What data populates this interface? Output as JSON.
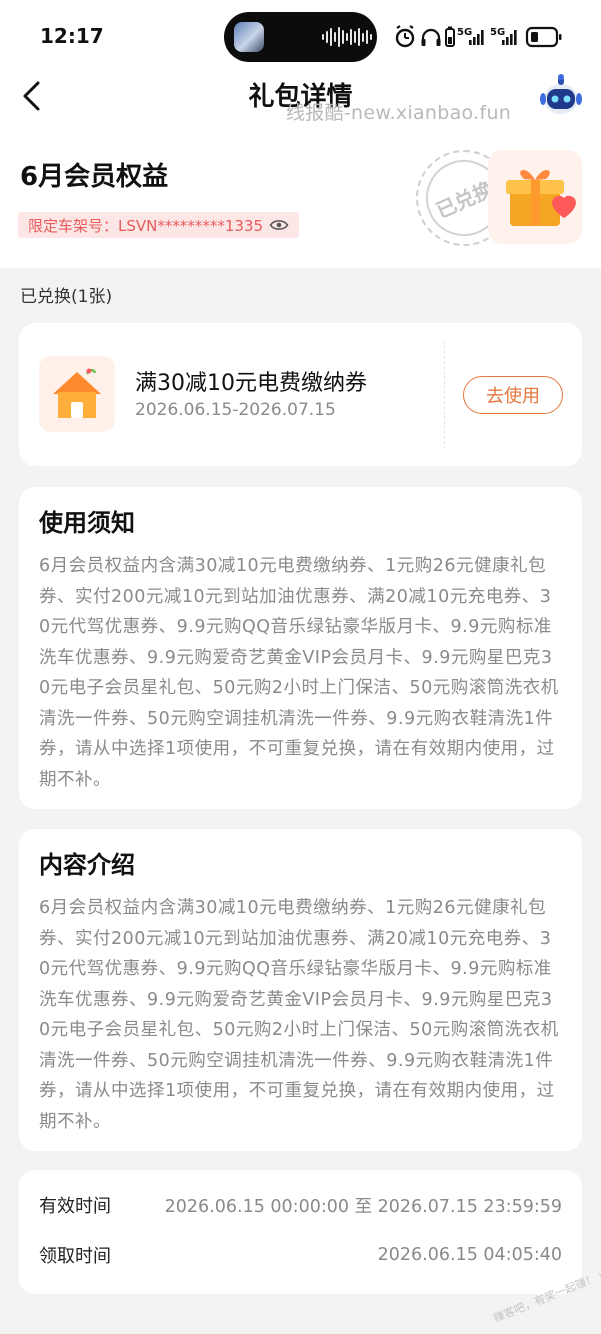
{
  "status_bar": {
    "time": "12:17",
    "network_label_1": "5G",
    "network_label_2": "5G"
  },
  "nav": {
    "title": "礼包详情",
    "back_icon": "chevron-left-icon",
    "avatar_icon": "robot-mascot-icon"
  },
  "watermark": "线报酷-new.xianbao.fun",
  "header": {
    "package_title": "6月会员权益",
    "vin_label": "限定车架号：LSVN*********1335",
    "eye_icon": "eye-icon",
    "stamp_text": "已兑换",
    "gift_icon": "gift-box-icon"
  },
  "redeemed": {
    "label": "已兑换(1张)"
  },
  "coupon": {
    "name": "满30减10元电费缴纳券",
    "validity": "2026.06.15-2026.07.15",
    "use_button": "去使用",
    "icon": "house-icon"
  },
  "notice": {
    "title": "使用须知",
    "body": "6月会员权益内含满30减10元电费缴纳券、1元购26元健康礼包券、实付200元减10元到站加油优惠券、满20减10元充电券、30元代驾优惠券、9.9元购QQ音乐绿钻豪华版月卡、9.9元购标准洗车优惠券、9.9元购爱奇艺黄金VIP会员月卡、9.9元购星巴克30元电子会员星礼包、50元购2小时上门保洁、50元购滚筒洗衣机清洗一件券、50元购空调挂机清洗一件券、9.9元购衣鞋清洗1件券，请从中选择1项使用，不可重复兑换，请在有效期内使用，过期不补。"
  },
  "intro": {
    "title": "内容介绍",
    "body": "6月会员权益内含满30减10元电费缴纳券、1元购26元健康礼包券、实付200元减10元到站加油优惠券、满20减10元充电券、30元代驾优惠券、9.9元购QQ音乐绿钻豪华版月卡、9.9元购标准洗车优惠券、9.9元购爱奇艺黄金VIP会员月卡、9.9元购星巴克30元电子会员星礼包、50元购2小时上门保洁、50元购滚筒洗衣机清洗一件券、50元购空调挂机清洗一件券、9.9元购衣鞋清洗1件券，请从中选择1项使用，不可重复兑换，请在有效期内使用，过期不补。"
  },
  "times": {
    "valid_label": "有效时间",
    "valid_value": "2026.06.15 00:00:00 至 2026.07.15 23:59:59",
    "receive_label": "领取时间",
    "receive_value": "2026.06.15 04:05:40"
  },
  "corner_watermark": "赚客吧，有奖一起赚！ www.zuanke8.com",
  "colors": {
    "accent_orange": "#e5773e",
    "vin_red": "#e85b5b",
    "vin_bg": "#fde6e6",
    "page_bg": "#f3f3f3"
  }
}
